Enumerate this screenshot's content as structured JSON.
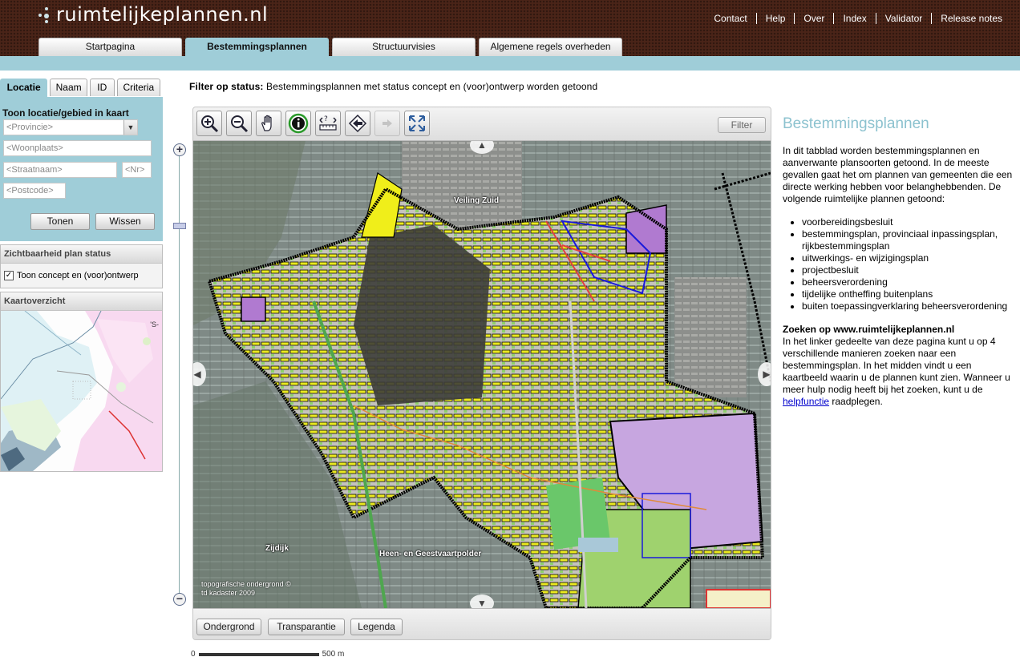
{
  "header": {
    "logo_text": "ruimtelijkeplannen.nl",
    "nav_links": [
      "Contact",
      "Help",
      "Over",
      "Index",
      "Validator",
      "Release notes"
    ],
    "tabs": [
      {
        "label": "Startpagina",
        "active": false
      },
      {
        "label": "Bestemmingsplannen",
        "active": true
      },
      {
        "label": "Structuurvisies",
        "active": false
      },
      {
        "label": "Algemene regels overheden",
        "active": false
      }
    ]
  },
  "left_panel": {
    "subtabs": [
      {
        "label": "Locatie",
        "active": true
      },
      {
        "label": "Naam",
        "active": false
      },
      {
        "label": "ID",
        "active": false
      },
      {
        "label": "Criteria",
        "active": false
      }
    ],
    "search": {
      "title": "Toon locatie/gebied in kaart",
      "provincie_placeholder": "<Provincie>",
      "woonplaats_placeholder": "<Woonplaats>",
      "straatnaam_placeholder": "<Straatnaam>",
      "nr_placeholder": "<Nr>",
      "postcode_placeholder": "<Postcode>",
      "show_button": "Tonen",
      "clear_button": "Wissen"
    },
    "status_box": {
      "title": "Zichtbaarheid plan status",
      "checkbox_label": "Toon concept en (voor)ontwerp",
      "checked": true
    },
    "overview_box": {
      "title": "Kaartoverzicht",
      "corner_text": "'S-"
    }
  },
  "filter_line": {
    "label": "Filter op status:",
    "text": "Bestemmingsplannen met status concept en (voor)ontwerp worden getoond"
  },
  "map": {
    "toolbar_icons": [
      "zoom-in-icon",
      "zoom-out-icon",
      "pan-hand-icon",
      "info-icon",
      "measure-icon",
      "previous-extent-icon",
      "next-extent-icon",
      "full-extent-icon"
    ],
    "filter_button": "Filter",
    "labels": {
      "veiling": "Veiling Zuid",
      "zijdijk": "Zijdijk",
      "heen": "Heen- en Geestvaartpolder"
    },
    "copyright_line1": "topografische ondergrond ©",
    "copyright_line2": "td kadaster 2009",
    "bottom_buttons": [
      "Ondergrond",
      "Transparantie",
      "Legenda"
    ],
    "scale_start": "0",
    "scale_end": "500 m",
    "zoom_plus": "+",
    "zoom_minus": "−"
  },
  "info": {
    "title": "Bestemmingsplannen",
    "intro": "In dit tabblad worden bestemmingsplannen en aanverwante plansoorten getoond. In de meeste gevallen gaat het om plannen van gemeenten die een directe werking hebben voor belanghebbenden. De volgende ruimtelijke plannen getoond:",
    "list": [
      "voorbereidingsbesluit",
      "bestemmingsplan, provinciaal inpassingsplan, rijkbestemmingsplan",
      "uitwerkings- en wijzigingsplan",
      "projectbesluit",
      "beheersverordening",
      "tijdelijke ontheffing buitenplans",
      "buiten toepassingverklaring beheersverordening"
    ],
    "search_title": "Zoeken op www.ruimtelijkeplannen.nl",
    "search_text": "In het linker gedeelte van deze pagina kunt u op 4 verschillende manieren zoeken naar een bestemmingsplan. In het midden vindt u een kaartbeeld waarin u de plannen kunt zien. Wanneer u meer hulp nodig heeft bij het zoeken, kunt u de",
    "help_link": "helpfunctie",
    "search_text_end": "raadplegen."
  }
}
